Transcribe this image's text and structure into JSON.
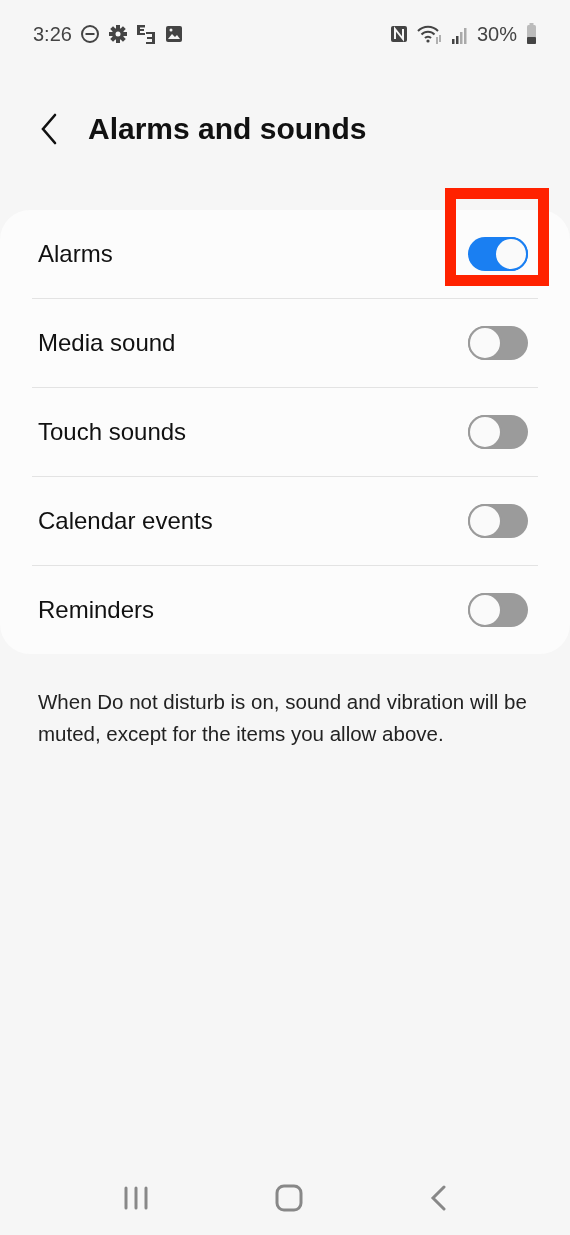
{
  "status_bar": {
    "time": "3:26",
    "battery": "30%"
  },
  "header": {
    "title": "Alarms and sounds"
  },
  "settings": [
    {
      "label": "Alarms",
      "on": true,
      "highlighted": true
    },
    {
      "label": "Media sound",
      "on": false,
      "highlighted": false
    },
    {
      "label": "Touch sounds",
      "on": false,
      "highlighted": false
    },
    {
      "label": "Calendar events",
      "on": false,
      "highlighted": false
    },
    {
      "label": "Reminders",
      "on": false,
      "highlighted": false
    }
  ],
  "footnote": "When Do not disturb is on, sound and vibration will be muted, except for the items you allow above."
}
